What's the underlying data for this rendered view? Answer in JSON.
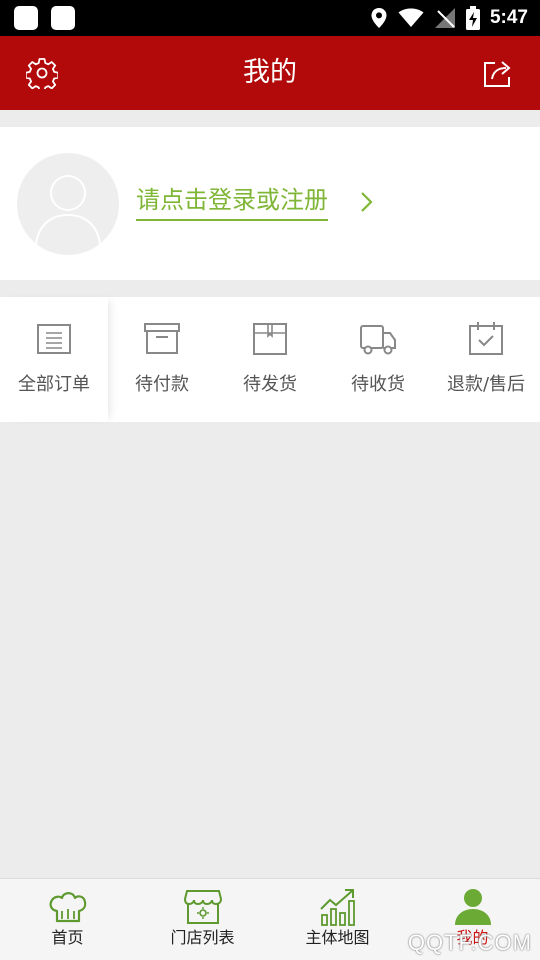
{
  "status_bar": {
    "time": "5:47"
  },
  "header": {
    "title": "我的"
  },
  "profile": {
    "login_prompt": "请点击登录或注册"
  },
  "orders": {
    "items": [
      {
        "label": "全部订单",
        "icon": "order-list-icon"
      },
      {
        "label": "待付款",
        "icon": "box-icon"
      },
      {
        "label": "待发货",
        "icon": "package-icon"
      },
      {
        "label": "待收货",
        "icon": "truck-icon"
      },
      {
        "label": "退款/售后",
        "icon": "calendar-check-icon"
      }
    ]
  },
  "tabbar": {
    "items": [
      {
        "label": "首页",
        "icon": "chef-hat-icon",
        "active": false
      },
      {
        "label": "门店列表",
        "icon": "store-icon",
        "active": false
      },
      {
        "label": "主体地图",
        "icon": "bar-chart-icon",
        "active": false
      },
      {
        "label": "我的",
        "icon": "user-icon",
        "active": true
      }
    ]
  },
  "watermark": "QQTF.COM",
  "colors": {
    "header": "#b20a0a",
    "accent_green": "#7fb636",
    "active_tab": "#cc1616"
  }
}
